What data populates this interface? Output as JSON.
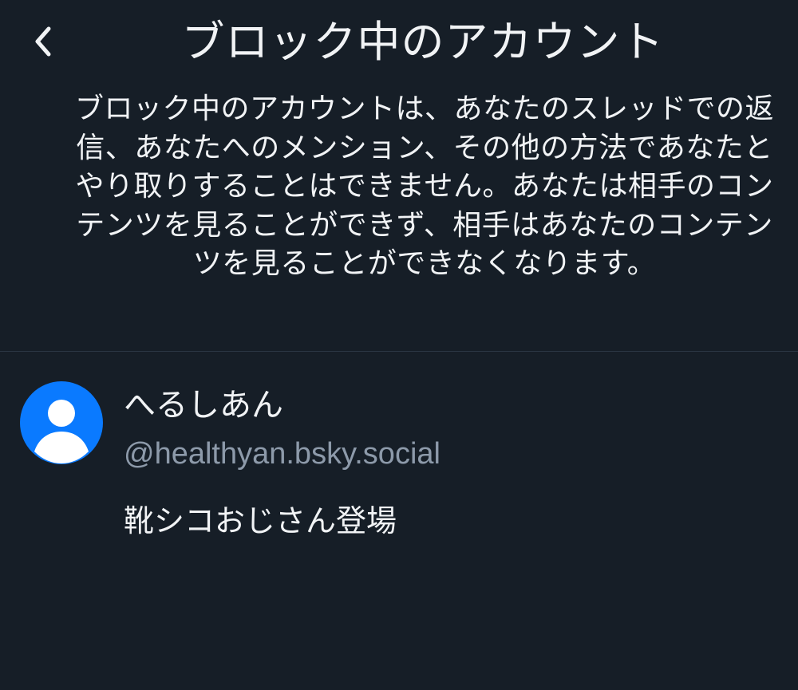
{
  "header": {
    "back_icon": "chevron-left-icon",
    "title": "ブロック中のアカウント"
  },
  "description": "ブロック中のアカウントは、あなたのスレッドでの返信、あなたへのメンション、その他の方法であなたとやり取りすることはできません。あなたは相手のコンテンツを見ることができず、相手はあなたのコンテンツを見ることができなくなります。",
  "blocked_accounts": [
    {
      "avatar_icon": "default-user-avatar-icon",
      "display_name": "へるしあん",
      "handle": "@healthyan.bsky.social",
      "bio": "靴シコおじさん登場"
    }
  ],
  "colors": {
    "background": "#161e27",
    "text": "#f1f3f5",
    "muted_text": "#8d9aaa",
    "divider": "#2a3542",
    "avatar_blue": "#0a7aff"
  }
}
